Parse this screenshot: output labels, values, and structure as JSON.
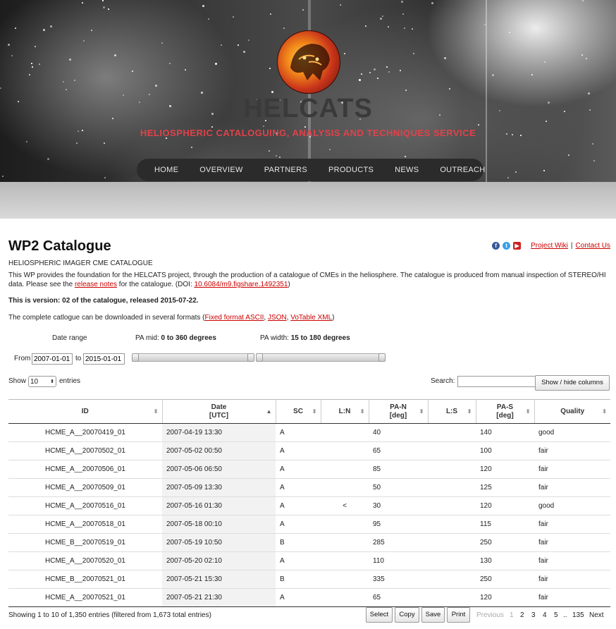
{
  "site": {
    "brand": "HELCATS",
    "tagline": "HELIOSPHERIC CATALOGUING, ANALYSIS AND TECHNIQUES SERVICE",
    "nav": [
      "HOME",
      "OVERVIEW",
      "PARTNERS",
      "PRODUCTS",
      "NEWS",
      "OUTREACH"
    ],
    "colors": {
      "tagline": "#e0424a",
      "link": "#cc0000",
      "nav_bg": "#2b2b2b"
    }
  },
  "page": {
    "title": "WP2 Catalogue",
    "subtitle": "HELIOSPHERIC IMAGER CME CATALOGUE",
    "desc_part1": "This WP provides the foundation for the HELCATS project, through the production of a catalogue of CMEs in the heliosphere. The catalogue is produced from manual inspection of STEREO/HI",
    "desc_part2": "data. Please see the ",
    "release_notes_link": "release notes",
    "desc_part3": " for the catalogue. (DOI: ",
    "doi_link": "10.6084/m9.figshare.1492351",
    "desc_part4": ")",
    "version": "This is version: 02 of the catalogue, released 2015-07-22.",
    "download_text": "The complete catlogue can be downloaded in several formats (",
    "download_links": [
      "Fixed format ASCII",
      "JSON",
      "VoTable XML"
    ],
    "download_sep": ", ",
    "download_end": ")",
    "project_wiki": "Project Wiki",
    "contact_us": "Contact Us",
    "link_sep": "|",
    "social_icons": [
      "facebook-icon",
      "twitter-icon",
      "youtube-icon"
    ]
  },
  "filters": {
    "date_range_label": "Date range",
    "from_label": "From",
    "from_value": "2007-01-01",
    "to_label": "to",
    "to_value": "2015-01-01",
    "pa_mid_label": "PA mid: ",
    "pa_mid_value": "0 to 360 degrees",
    "pa_width_label": "PA width: ",
    "pa_width_value": "15 to 180 degrees"
  },
  "table_controls": {
    "show_label": "Show",
    "entries_label": "entries",
    "page_size": "10",
    "search_label": "Search:",
    "search_value": "",
    "show_hide_button": "Show / hide columns"
  },
  "table": {
    "columns": [
      {
        "label": "ID",
        "sub": ""
      },
      {
        "label": "Date",
        "sub": "[UTC]"
      },
      {
        "label": "SC",
        "sub": ""
      },
      {
        "label": "L:N",
        "sub": ""
      },
      {
        "label": "PA-N",
        "sub": "[deg]"
      },
      {
        "label": "L:S",
        "sub": ""
      },
      {
        "label": "PA-S",
        "sub": "[deg]"
      },
      {
        "label": "Quality",
        "sub": ""
      }
    ],
    "sort_column": "Date",
    "rows": [
      [
        "HCME_A__20070419_01",
        "2007-04-19 13:30",
        "A",
        "",
        "40",
        "",
        "140",
        "good"
      ],
      [
        "HCME_A__20070502_01",
        "2007-05-02 00:50",
        "A",
        "",
        "65",
        "",
        "100",
        "fair"
      ],
      [
        "HCME_A__20070506_01",
        "2007-05-06 06:50",
        "A",
        "",
        "85",
        "",
        "120",
        "fair"
      ],
      [
        "HCME_A__20070509_01",
        "2007-05-09 13:30",
        "A",
        "",
        "50",
        "",
        "125",
        "fair"
      ],
      [
        "HCME_A__20070516_01",
        "2007-05-16 01:30",
        "A",
        "<",
        "30",
        "",
        "120",
        "good"
      ],
      [
        "HCME_A__20070518_01",
        "2007-05-18 00:10",
        "A",
        "",
        "95",
        "",
        "115",
        "fair"
      ],
      [
        "HCME_B__20070519_01",
        "2007-05-19 10:50",
        "B",
        "",
        "285",
        "",
        "250",
        "fair"
      ],
      [
        "HCME_A__20070520_01",
        "2007-05-20 02:10",
        "A",
        "",
        "110",
        "",
        "130",
        "fair"
      ],
      [
        "HCME_B__20070521_01",
        "2007-05-21 15:30",
        "B",
        "",
        "335",
        "",
        "250",
        "fair"
      ],
      [
        "HCME_A__20070521_01",
        "2007-05-21 21:30",
        "A",
        "",
        "65",
        "",
        "120",
        "fair"
      ]
    ]
  },
  "footer": {
    "info": "Showing 1 to 10 of 1,350 entries (filtered from 1,673 total entries)",
    "buttons": [
      "Select",
      "Copy",
      "Save",
      "Print"
    ],
    "previous": "Previous",
    "pages": [
      "1",
      "2",
      "3",
      "4",
      "5"
    ],
    "ellipsis": "..",
    "last_page": "135",
    "next": "Next"
  }
}
